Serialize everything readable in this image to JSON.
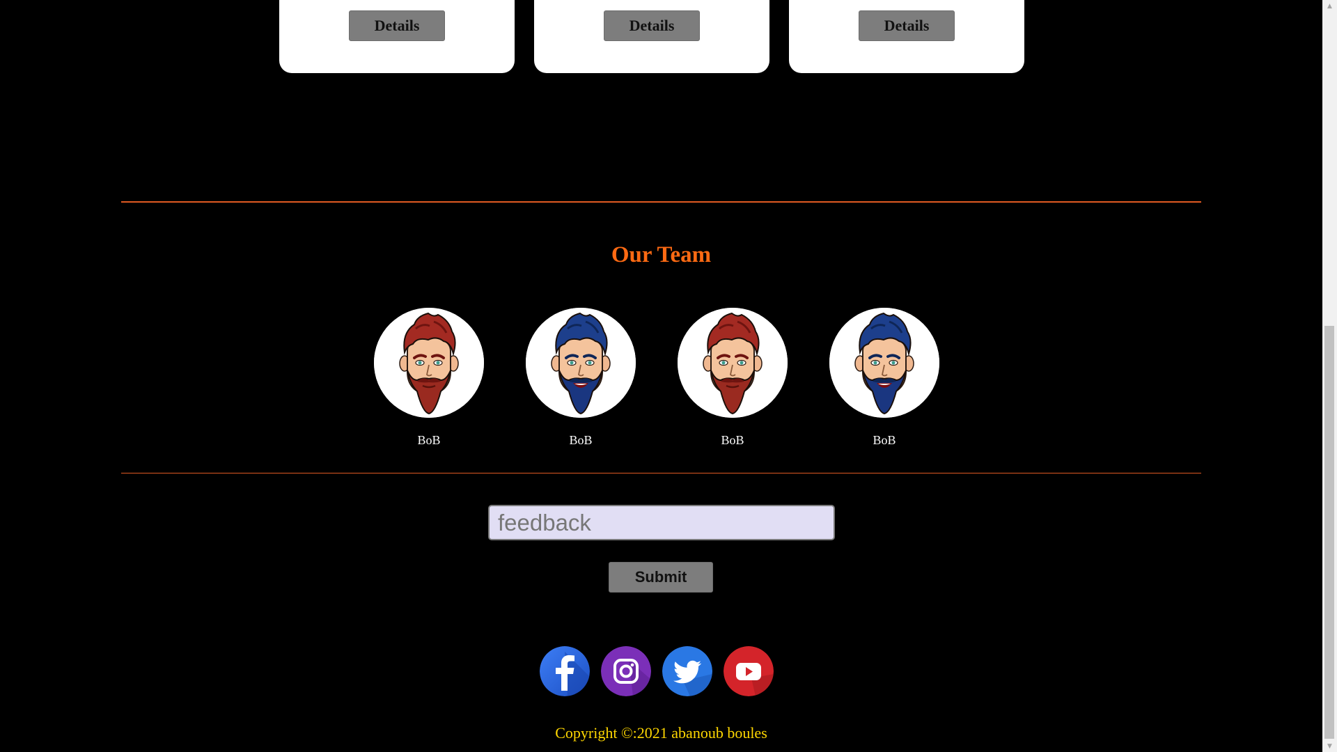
{
  "cards": [
    {
      "details_label": "Details"
    },
    {
      "details_label": "Details"
    },
    {
      "details_label": "Details"
    }
  ],
  "team": {
    "title": "Our Team",
    "members": [
      {
        "name": "BoB",
        "hair": "red"
      },
      {
        "name": "BoB",
        "hair": "blue"
      },
      {
        "name": "BoB",
        "hair": "red"
      },
      {
        "name": "BoB",
        "hair": "blue"
      }
    ]
  },
  "feedback": {
    "placeholder": "feedback",
    "value": "",
    "submit_label": "Submit"
  },
  "socials": [
    {
      "icon": "facebook-icon",
      "color": "#2d6be4"
    },
    {
      "icon": "instagram-icon",
      "color": "#7b2fb8"
    },
    {
      "icon": "twitter-icon",
      "color": "#2a78e4"
    },
    {
      "icon": "youtube-icon",
      "color": "#d4242a"
    }
  ],
  "footer": {
    "copyright": "Copyright ©:2021 abanoub boules"
  },
  "colors": {
    "accent": "#ff6a13",
    "divider": "#e05a22",
    "copyright": "#ffd700",
    "button": "#7d7d7d",
    "input_bg": "#e1def4"
  }
}
